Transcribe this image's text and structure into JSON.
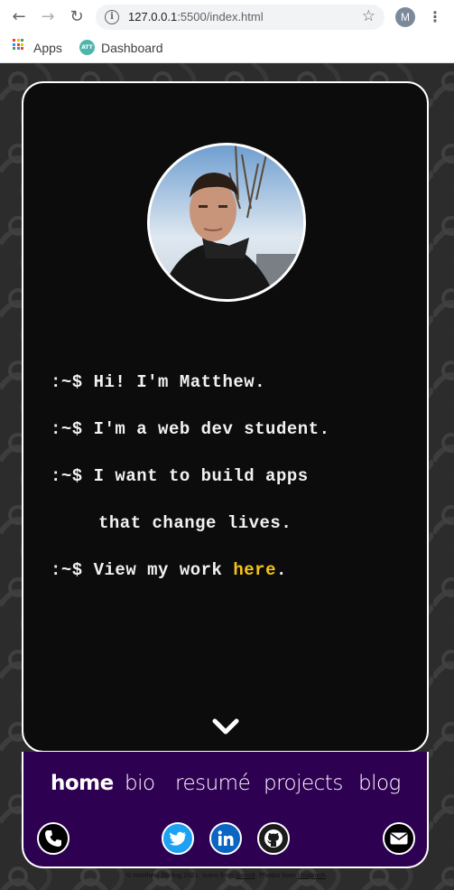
{
  "browser": {
    "url_host": "127.0.0.1",
    "url_rest": ":5500/index.html",
    "profile_initial": "M",
    "bookmarks": [
      {
        "label": "Apps"
      },
      {
        "label": "Dashboard"
      }
    ]
  },
  "terminal": {
    "prompt": ":~$",
    "lines": [
      "Hi! I'm Matthew.",
      "I'm a web dev student.",
      "I want to build apps",
      "that change lives.",
      "View my work "
    ],
    "link_text": "here",
    "link_suffix": "."
  },
  "nav": {
    "items": [
      {
        "label": "home",
        "active": true
      },
      {
        "label": "bio",
        "active": false
      },
      {
        "label": "resumé",
        "active": false
      },
      {
        "label": "projects",
        "active": false
      },
      {
        "label": "blog",
        "active": false
      }
    ]
  },
  "social": [
    "phone-icon",
    "twitter-icon",
    "linkedin-icon",
    "github-icon",
    "mail-icon"
  ],
  "colors": {
    "card_bg": "#0c0c0c",
    "footer_bg": "#2e0052",
    "link": "#f5c518",
    "twitter": "#1da1f2",
    "linkedin": "#0a66c2"
  },
  "copyright": {
    "prefix": "© Matthew Stirling 2021. Icons from ",
    "icons_link": "icons8",
    "middle": ". Photos from ",
    "photos_link": "Unsplash",
    "suffix": "."
  }
}
